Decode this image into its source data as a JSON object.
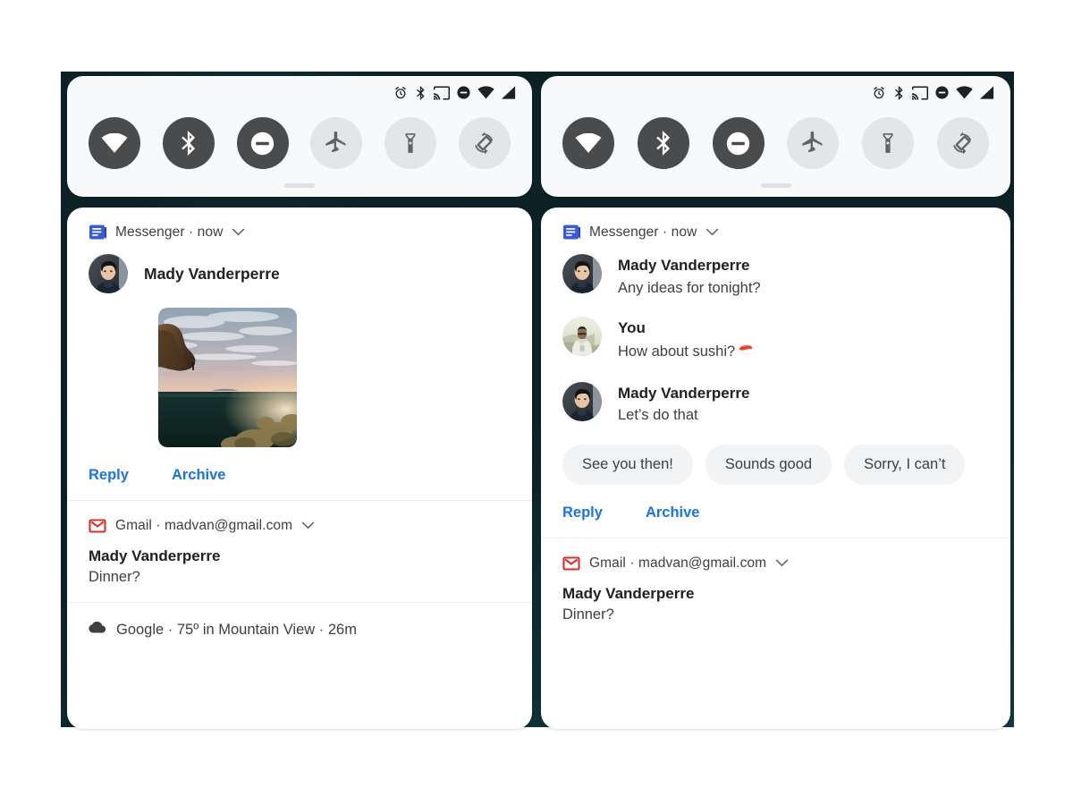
{
  "theme": {
    "page_background": "#ffffff",
    "wallpaper": "#0d2226",
    "panel_background": "#f8f9fb",
    "shade_background": "#ffffff",
    "accent_link": "#1a73e8",
    "tile_on": "#4a4b4d",
    "tile_off": "#e3e5e8",
    "text_primary": "#202124",
    "text_secondary": "#3c4043",
    "chip_background": "#f1f3f4",
    "gmail_red": "#d93025",
    "messenger_blue": "#3b5bdb"
  },
  "status_bar": {
    "icons": [
      "alarm-icon",
      "bluetooth-icon",
      "cast-icon",
      "do-not-disturb-icon",
      "wifi-icon",
      "cellular-signal-icon"
    ]
  },
  "quick_settings": {
    "tiles": [
      {
        "name": "wifi",
        "icon": "wifi-icon",
        "state": "on"
      },
      {
        "name": "bluetooth",
        "icon": "bluetooth-icon",
        "state": "on"
      },
      {
        "name": "do-not-disturb",
        "icon": "do-not-disturb-icon",
        "state": "on"
      },
      {
        "name": "airplane-mode",
        "icon": "airplane-icon",
        "state": "off"
      },
      {
        "name": "flashlight",
        "icon": "flashlight-icon",
        "state": "off"
      },
      {
        "name": "auto-rotate",
        "icon": "auto-rotate-icon",
        "state": "off"
      }
    ],
    "drag_handle": "drag-handle"
  },
  "left_panel": {
    "messenger": {
      "app_name": "Messenger",
      "separator": "·",
      "time": "now",
      "header_text": "Messenger · now",
      "app_icon": "messenger-icon",
      "expand_icon": "chevron-down-icon",
      "sender": "Mady Vanderperre",
      "avatar": "avatar-mady",
      "attachment": "photo-sunset-cliff",
      "actions": {
        "reply": "Reply",
        "archive": "Archive"
      }
    },
    "gmail": {
      "app_name": "Gmail",
      "account": "madvan@gmail.com",
      "header_text": "Gmail · madvan@gmail.com",
      "app_icon": "gmail-icon",
      "expand_icon": "chevron-down-icon",
      "sender": "Mady Vanderperre",
      "subject": "Dinner?"
    },
    "google_weather": {
      "app_name": "Google",
      "summary": "75º in Mountain View",
      "time": "26m",
      "header_text": "Google · 75º in Mountain View · 26m",
      "app_icon": "cloud-icon"
    }
  },
  "right_panel": {
    "messenger": {
      "app_name": "Messenger",
      "time": "now",
      "header_text": "Messenger · now",
      "app_icon": "messenger-icon",
      "expand_icon": "chevron-down-icon",
      "messages": [
        {
          "sender": "Mady Vanderperre",
          "text": "Any ideas for tonight?",
          "avatar": "avatar-mady"
        },
        {
          "sender": "You",
          "text": "How about sushi?",
          "emoji": "sushi-emoji",
          "avatar": "avatar-you"
        },
        {
          "sender": "Mady Vanderperre",
          "text": "Let’s do that",
          "avatar": "avatar-mady"
        }
      ],
      "smart_replies": [
        "See you then!",
        "Sounds good",
        "Sorry, I can’t"
      ],
      "actions": {
        "reply": "Reply",
        "archive": "Archive"
      }
    },
    "gmail": {
      "app_name": "Gmail",
      "account": "madvan@gmail.com",
      "header_text": "Gmail · madvan@gmail.com",
      "app_icon": "gmail-icon",
      "expand_icon": "chevron-down-icon",
      "sender": "Mady Vanderperre",
      "subject": "Dinner?"
    }
  }
}
